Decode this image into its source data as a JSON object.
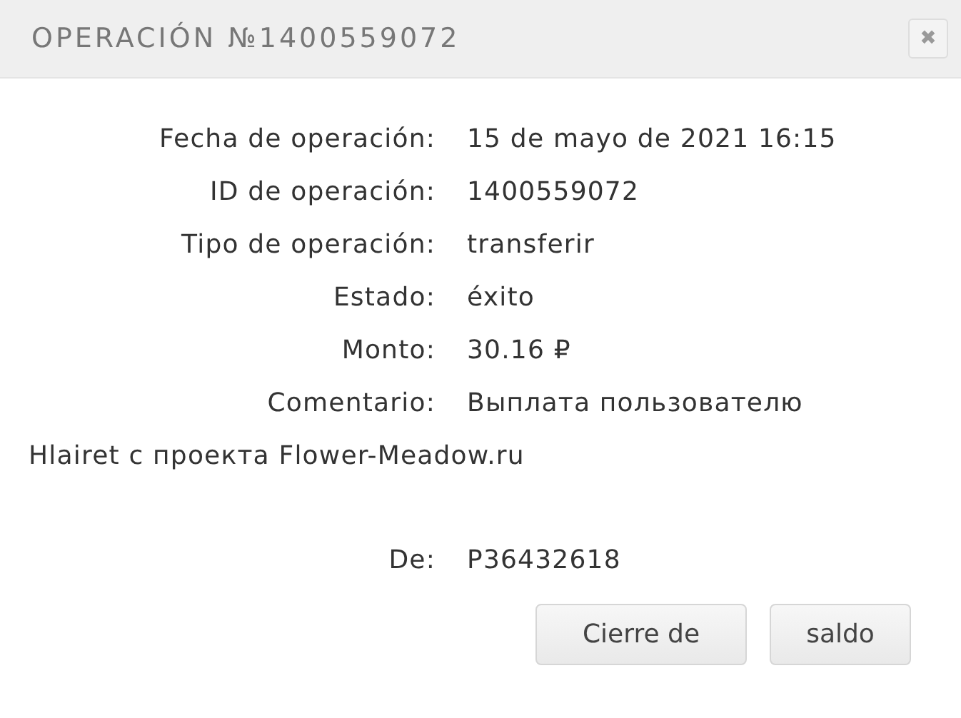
{
  "window": {
    "title": "OPERACIÓN №1400559072",
    "close": "✖"
  },
  "fields": [
    {
      "label": "Fecha de operación:",
      "value": "15 de mayo de 2021 16:15"
    },
    {
      "label": "ID de operación:",
      "value": "1400559072"
    },
    {
      "label": "Tipo de operación:",
      "value": "transferir"
    },
    {
      "label": "Estado:",
      "value": "éxito"
    },
    {
      "label": "Monto:",
      "value": "30.16 ₽"
    },
    {
      "label": "Comentario:",
      "value": "Выплата пользователю",
      "continuation": "Hlairet с проекта Flower-Meadow.ru"
    }
  ],
  "sender": {
    "label": "De:",
    "value": "P36432618"
  },
  "buttons": [
    "Cierre de",
    "saldo"
  ]
}
